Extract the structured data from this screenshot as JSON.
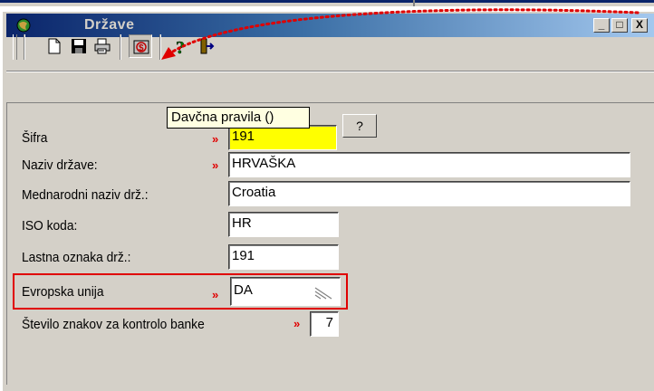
{
  "window": {
    "title": "Države",
    "controls": {
      "minimize": "_",
      "maximize": "□",
      "close": "X"
    }
  },
  "toolbar": {
    "buttons": [
      {
        "icon": "new-document-icon"
      },
      {
        "icon": "save-icon"
      },
      {
        "icon": "print-icon"
      },
      {
        "icon": "tax-rules-icon",
        "pressed": true
      },
      {
        "icon": "help-icon"
      },
      {
        "icon": "exit-icon"
      }
    ],
    "tooltip": "Davčna pravila ()"
  },
  "form": {
    "sifra": {
      "label": "Šifra",
      "value": "191",
      "required_marker": "»",
      "help_button": "?"
    },
    "naziv": {
      "label": "Naziv države:",
      "value": "HRVAŠKA",
      "required_marker": "»"
    },
    "mednarodni": {
      "label": "Mednarodni naziv drž.:",
      "value": "Croatia"
    },
    "iso": {
      "label": "ISO koda:",
      "value": "HR"
    },
    "lastna": {
      "label": "Lastna oznaka drž.:",
      "value": "191"
    },
    "eu": {
      "label": "Evropska unija",
      "value": "DA",
      "required_marker": "»"
    },
    "stevilo": {
      "label": "Število znakov za kontrolo banke",
      "value": "7",
      "required_marker": "»"
    }
  },
  "colors": {
    "annotation_red": "#e00000",
    "required_field": "#ffff00",
    "tooltip_bg": "#ffffe1"
  }
}
